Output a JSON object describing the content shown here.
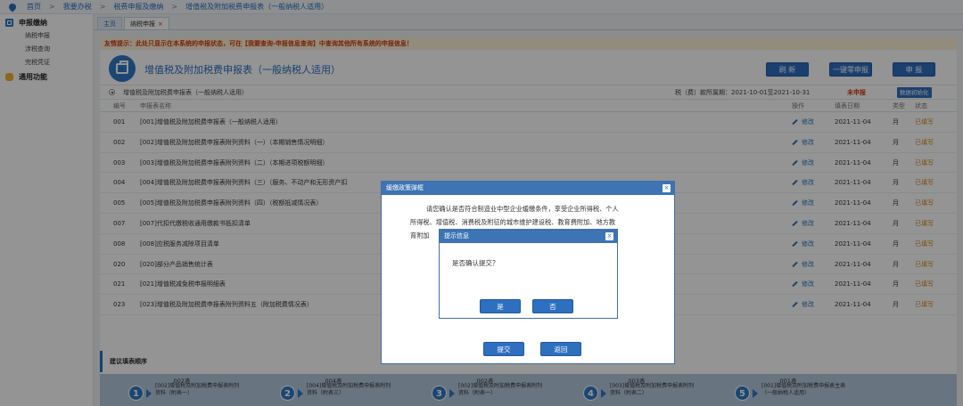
{
  "breadcrumb": [
    "首页",
    "我要办税",
    "税费申报及缴纳",
    "增值税及附加税费申报表（一般纳税人适用）"
  ],
  "breadcrumb_sep": ">",
  "sidebar": {
    "group1": "申报缴纳",
    "items": [
      "纳税申报",
      "涉税查询",
      "完税凭证"
    ],
    "group2": "通用功能"
  },
  "tabs": [
    {
      "label": "主页",
      "active": false
    },
    {
      "label": "纳税申报",
      "active": true,
      "close": "×"
    }
  ],
  "notice": "友情提示：此处只显示在本系统的申报状态，可在【我要查询-申报信息查询】中查询其他所有系统的申报信息！",
  "header": {
    "title": "增值税及附加税费申报表（一般纳税人适用）",
    "refresh_label": "刷 新",
    "zero_label": "一键零申报",
    "declare_label": "申 报"
  },
  "subbar": {
    "name": "增值税及附加税费申报表（一般纳税人适用）",
    "period": "税（费）款所属期：2021-10-01至2021-10-31",
    "status": "未申报",
    "init_label": "数据初始化"
  },
  "table": {
    "headers": {
      "no": "编号",
      "name": "申报表名称",
      "op": "操作",
      "date": "填表日期",
      "type": "类型",
      "status": "状态"
    },
    "rows": [
      {
        "no": "001",
        "name": "[001]增值税及附加税费申报表（一般纳税人适用）",
        "op": "修改",
        "date": "2021-11-04",
        "type": "月",
        "status": "已填写"
      },
      {
        "no": "002",
        "name": "[002]增值税及附加税费申报表附列资料（一）（本期销售情况明细）",
        "op": "修改",
        "date": "2021-11-04",
        "type": "月",
        "status": "已填写"
      },
      {
        "no": "003",
        "name": "[003]增值税及附加税费申报表附列资料（二）（本期进项税额明细）",
        "op": "修改",
        "date": "2021-11-04",
        "type": "月",
        "status": "已填写"
      },
      {
        "no": "004",
        "name": "[004]增值税及附加税费申报表附列资料（三）（服务、不动产和无形资产扣",
        "op": "修改",
        "date": "2021-11-04",
        "type": "月",
        "status": "已填写"
      },
      {
        "no": "005",
        "name": "[005]增值税及附加税费申报表附列资料（四）（税额抵减情况表）",
        "op": "修改",
        "date": "2021-11-04",
        "type": "月",
        "status": "已填写"
      },
      {
        "no": "007",
        "name": "[007]代扣代缴税收通用缴款书抵扣清单",
        "op": "修改",
        "date": "2021-11-04",
        "type": "月",
        "status": "已填写"
      },
      {
        "no": "008",
        "name": "[008]应税服务减除项目清单",
        "op": "修改",
        "date": "2021-11-04",
        "type": "月",
        "status": "已填写"
      },
      {
        "no": "020",
        "name": "[020]部分产品销售统计表",
        "op": "修改",
        "date": "2021-11-04",
        "type": "月",
        "status": "已填写"
      },
      {
        "no": "021",
        "name": "[021]增值税减免税申报明细表",
        "op": "修改",
        "date": "2021-11-04",
        "type": "月",
        "status": "已填写"
      },
      {
        "no": "023",
        "name": "[023]增值税及附加税费申报表附列资料五（附加税费情况表）",
        "op": "修改",
        "date": "2021-11-04",
        "type": "月",
        "status": "已填写"
      }
    ]
  },
  "suggest_title": "建议填表顺序",
  "steps": [
    {
      "num": "1",
      "label": "002表",
      "desc": "[002]增值税及附加税费申报表附列资料（附表一）"
    },
    {
      "num": "2",
      "label": "004表",
      "desc": "[004]增值税及附加税费申报表附列资料（附表三）"
    },
    {
      "num": "3",
      "label": "002表",
      "desc": "[002]增值税及附加税费申报表附列资料（附表一）"
    },
    {
      "num": "4",
      "label": "003表",
      "desc": "[003]增值税及附加税费申报表附列资料（附表二）"
    },
    {
      "num": "5",
      "label": "001表",
      "desc": "[001]增值税及附加税费申报表主表（一般纳税人适用）"
    }
  ],
  "dialog_policy": {
    "title": "缓缴政策弹框",
    "close": "×",
    "line1": "请您确认是否符合制造业中型企业缓缴条件，享受企业所得税、个人",
    "line2": "所得税、增值税、消费税及附征的城市维护建设税、教育费附加、地方教",
    "line3": "育附加",
    "submit_label": "提交",
    "back_label": "返回"
  },
  "dialog_confirm": {
    "title": "提示信息",
    "close": "×",
    "message": "是否确认提交？",
    "yes_label": "是",
    "no_label": "否"
  },
  "colors": {
    "accent": "#2f6fbf",
    "warning": "#d8861a",
    "notice": "#d03a1a",
    "overlay": "rgba(0,0,0,0.42)"
  }
}
